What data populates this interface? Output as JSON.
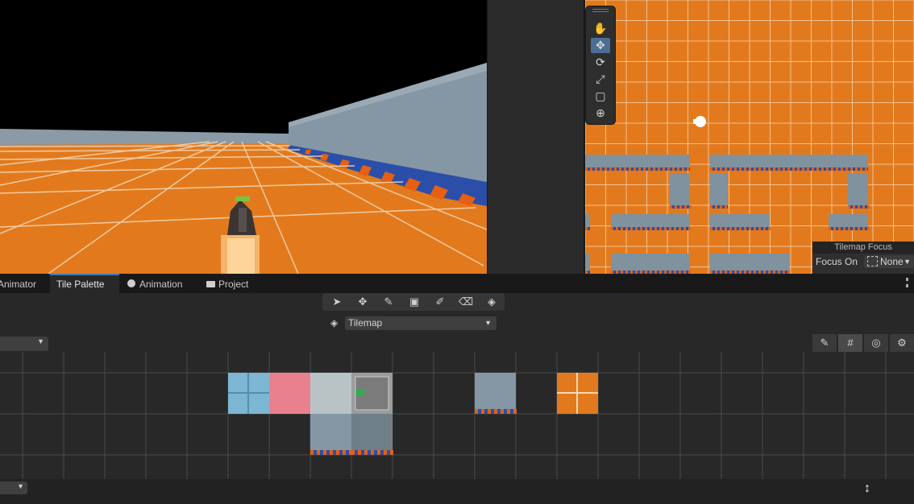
{
  "tabs": [
    {
      "label": "Animator",
      "icon": "",
      "active": false
    },
    {
      "label": "Tile Palette",
      "icon": "",
      "active": true
    },
    {
      "label": "Animation",
      "icon": "clock-icon",
      "active": false
    },
    {
      "label": "Project",
      "icon": "folder-icon",
      "active": false
    }
  ],
  "tilemap_focus": {
    "title": "Tilemap Focus",
    "label": "Focus On",
    "value": "None"
  },
  "palette": {
    "target_tilemap": "Tilemap"
  },
  "colors": {
    "floor_orange": "#e27a1d",
    "wall_gray": "#7f929e",
    "accent_blue": "#3a79bb"
  }
}
